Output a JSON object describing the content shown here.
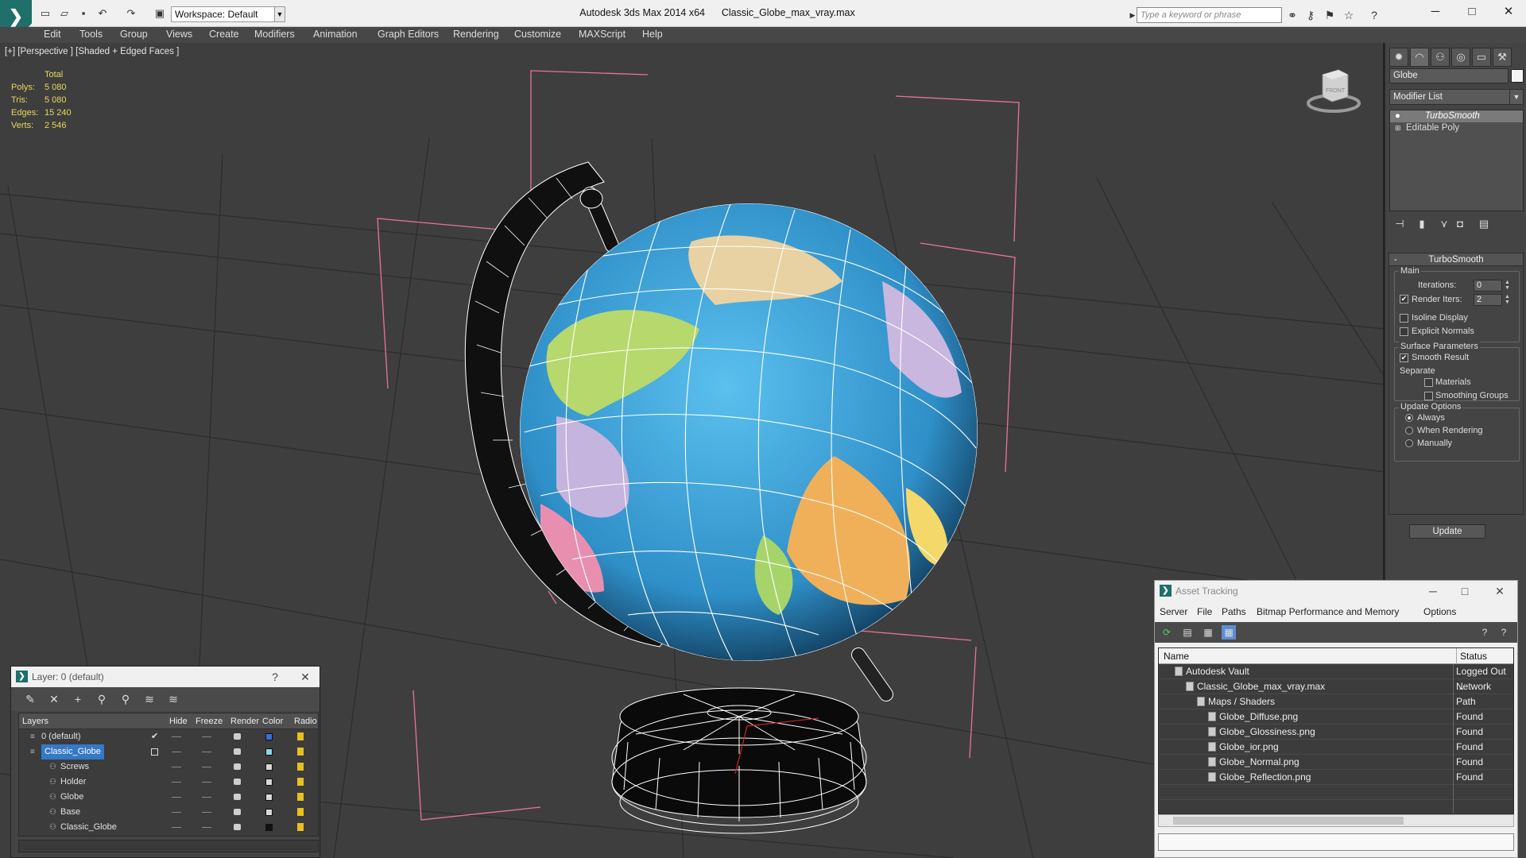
{
  "app": {
    "title": "Autodesk 3ds Max  2014 x64",
    "file": "Classic_Globe_max_vray.max",
    "workspace": "Workspace: Default",
    "search_placeholder": "Type a keyword or phrase"
  },
  "menu": [
    "Edit",
    "Tools",
    "Group",
    "Views",
    "Create",
    "Modifiers",
    "Animation",
    "Graph Editors",
    "Rendering",
    "Customize",
    "MAXScript",
    "Help"
  ],
  "viewport": {
    "label": "[+] [Perspective ] [Shaded + Edged Faces ]",
    "stats": {
      "header": "Total",
      "rows": [
        {
          "k": "Polys:",
          "v": "5 080"
        },
        {
          "k": "Tris:",
          "v": "5 080"
        },
        {
          "k": "Edges:",
          "v": "15 240"
        },
        {
          "k": "Verts:",
          "v": "2 546"
        }
      ]
    },
    "viewcube_label": "FRONT"
  },
  "command_panel": {
    "object_name": "Globe",
    "modifier_list": "Modifier List",
    "stack": [
      "TurboSmooth",
      "Editable Poly"
    ],
    "rollout": {
      "title": "TurboSmooth",
      "main": "Main",
      "iterations_label": "Iterations:",
      "iterations_value": "0",
      "render_iters_label": "Render Iters:",
      "render_iters_value": "2",
      "isoline": "Isoline Display",
      "explicit_normals": "Explicit Normals",
      "surface_params": "Surface Parameters",
      "smooth_result": "Smooth Result",
      "separate": "Separate",
      "materials": "Materials",
      "smoothing_groups": "Smoothing Groups",
      "update_options": "Update Options",
      "always": "Always",
      "when_rendering": "When Rendering",
      "manually": "Manually",
      "update_button": "Update"
    }
  },
  "layer_window": {
    "title": "Layer: 0 (default)",
    "help": "?",
    "columns": [
      "Layers",
      "Hide",
      "Freeze",
      "Render",
      "Color",
      "Radio"
    ],
    "rows": [
      {
        "name": "0 (default)",
        "indent": 0,
        "color": "#3a6fd8",
        "selected": false
      },
      {
        "name": "Classic_Globe",
        "indent": 0,
        "color": "#8fd3e8",
        "selected": true
      },
      {
        "name": "Screws",
        "indent": 1,
        "color": "#d8d8d8",
        "selected": false
      },
      {
        "name": "Holder",
        "indent": 1,
        "color": "#d8d8d8",
        "selected": false
      },
      {
        "name": "Globe",
        "indent": 1,
        "color": "#d8d8d8",
        "selected": false
      },
      {
        "name": "Base",
        "indent": 1,
        "color": "#d8d8d8",
        "selected": false
      },
      {
        "name": "Classic_Globe",
        "indent": 1,
        "color": "#111111",
        "selected": false
      }
    ]
  },
  "asset_window": {
    "title": "Asset Tracking",
    "menu": [
      "Server",
      "File",
      "Paths",
      "Bitmap Performance and Memory",
      "Options"
    ],
    "columns": [
      "Name",
      "Status"
    ],
    "rows": [
      {
        "name": "Autodesk Vault",
        "status": "Logged Out ...",
        "indent": 0
      },
      {
        "name": "Classic_Globe_max_vray.max",
        "status": "Network Path",
        "indent": 1
      },
      {
        "name": "Maps / Shaders",
        "status": "",
        "indent": 2
      },
      {
        "name": "Globe_Diffuse.png",
        "status": "Found",
        "indent": 3
      },
      {
        "name": "Globe_Glossiness.png",
        "status": "Found",
        "indent": 3
      },
      {
        "name": "Globe_ior.png",
        "status": "Found",
        "indent": 3
      },
      {
        "name": "Globe_Normal.png",
        "status": "Found",
        "indent": 3
      },
      {
        "name": "Globe_Reflection.png",
        "status": "Found",
        "indent": 3
      }
    ]
  }
}
